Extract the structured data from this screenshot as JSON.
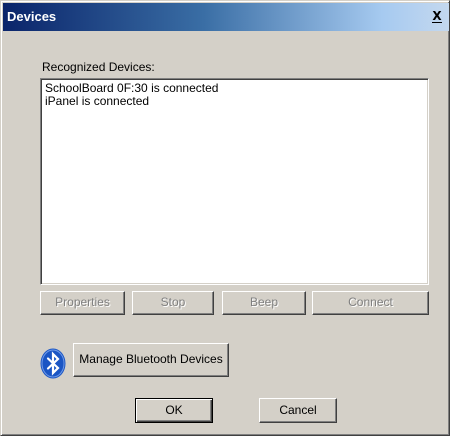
{
  "window": {
    "title": "Devices",
    "close_glyph": "X"
  },
  "list": {
    "label": "Recognized Devices:",
    "items": [
      "SchoolBoard 0F:30 is connected",
      "iPanel is connected"
    ]
  },
  "actions": {
    "properties_label": "Properties",
    "stop_label": "Stop",
    "beep_label": "Beep",
    "connect_label": "Connect"
  },
  "bluetooth": {
    "icon": "bluetooth-icon",
    "manage_label": "Manage Bluetooth Devices"
  },
  "footer": {
    "ok_label": "OK",
    "cancel_label": "Cancel"
  },
  "colors": {
    "dialog_face": "#d4d0c8",
    "title_start": "#0a246a",
    "title_end": "#a6caf0",
    "bluetooth_blue": "#1a55c4"
  }
}
